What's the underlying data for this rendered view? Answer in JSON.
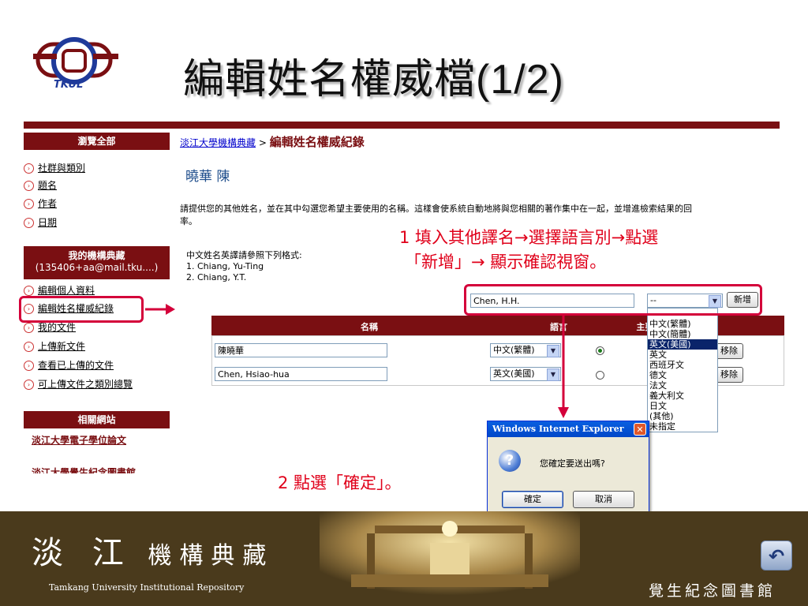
{
  "slide": {
    "title": "編輯姓名權威檔(1/2)",
    "logo_text": "TKUL"
  },
  "sidebar": {
    "browse_header": "瀏覽全部",
    "browse_items": [
      {
        "label": "社群與類別"
      },
      {
        "label": "題名"
      },
      {
        "label": "作者"
      },
      {
        "label": "日期"
      }
    ],
    "my_header": "我的機構典藏",
    "my_user": "(135406+aa@mail.tku....)",
    "my_items": [
      {
        "label": "編輯個人資料"
      },
      {
        "label": "編輯姓名權威紀錄"
      },
      {
        "label": "我的文件"
      },
      {
        "label": "上傳新文件"
      },
      {
        "label": "查看已上傳的文件"
      },
      {
        "label": "可上傳文件之類別總覽"
      }
    ],
    "related_header": "相關網站",
    "related_items": [
      {
        "label": "淡江大學電子學位論文"
      },
      {
        "label": "淡江大學覺生紀念圖書館"
      }
    ]
  },
  "main": {
    "breadcrumb_link": "淡江大學機構典藏",
    "breadcrumb_sep": ">",
    "breadcrumb_current": "編輯姓名權威紀錄",
    "person_name": "曉華 陳",
    "instruction_line1": "請提供您的其他姓名，並在其中勾選您希望主要使用的名稱。這樣會使系統自動地將與您相關的著作集中在一起，並增進檢索結果的回",
    "instruction_line2": "率。",
    "format_label": "中文姓名英譯請參照下列格式:",
    "format_examples": [
      "1. Chiang, Yu-Ting",
      "2. Chiang, Y.T."
    ],
    "new_name_value": "Chen, H.H.",
    "new_lang_value": "--",
    "add_button": "新增",
    "table_headers": {
      "name": "名稱",
      "language": "語言",
      "primary": "主要使"
    },
    "rows": [
      {
        "name": "陳曉華",
        "language": "中文(繁體)",
        "primary": true,
        "remove": "移除"
      },
      {
        "name": "Chen, Hsiao-hua",
        "language": "英文(美國)",
        "primary": false,
        "remove": "移除"
      }
    ],
    "lang_options": [
      "--",
      "中文(繁體)",
      "中文(簡體)",
      "英文(美國)",
      "英文",
      "西班牙文",
      "德文",
      "法文",
      "義大利文",
      "日文",
      "(其他)",
      "未指定"
    ],
    "lang_highlight_index": 3
  },
  "dialog": {
    "title": "Windows Internet Explorer",
    "message": "您確定要送出嗎?",
    "ok": "確定",
    "cancel": "取消"
  },
  "annotations": {
    "step1_line1": "1  填入其他譯名→選擇語言別→點選",
    "step1_line2": "「新增」→ 顯示確認視窗。",
    "step2": "2  點選「確定」。"
  },
  "footer": {
    "brand_big": "淡 江",
    "brand_small": "機構典藏",
    "brand_en": "Tamkang University Institutional Repository",
    "library": "覺生紀念圖書館",
    "back_icon": "↶"
  },
  "colors": {
    "accent": "#7a0f12",
    "annotation": "#e0001a",
    "footer": "#4a3a1c"
  }
}
